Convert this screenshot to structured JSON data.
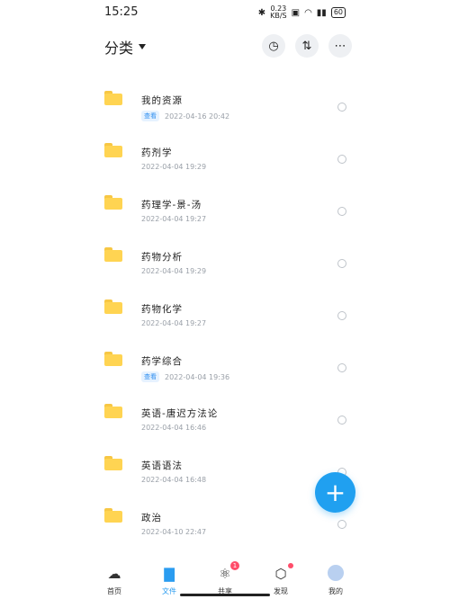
{
  "status": {
    "time": "15:25",
    "net_speed_top": "0.23",
    "net_speed_bottom": "KB/S",
    "battery": "60"
  },
  "header": {
    "title": "分类",
    "history_icon": "history-icon",
    "sort_icon": "sort-icon",
    "more_icon": "more-icon"
  },
  "files": [
    {
      "name": "我的资源",
      "tag": "查看",
      "date": "2022-04-16  20:42"
    },
    {
      "name": "药剂学",
      "tag": "",
      "date": "2022-04-04  19:29"
    },
    {
      "name": "药理学-景-汤",
      "tag": "",
      "date": "2022-04-04  19:27"
    },
    {
      "name": "药物分析",
      "tag": "",
      "date": "2022-04-04  19:29"
    },
    {
      "name": "药物化学",
      "tag": "",
      "date": "2022-04-04  19:27"
    },
    {
      "name": "药学综合",
      "tag": "查看",
      "date": "2022-04-04  19:36"
    },
    {
      "name": "英语-唐迟方法论",
      "tag": "",
      "date": "2022-04-04  16:46"
    },
    {
      "name": "英语语法",
      "tag": "",
      "date": "2022-04-04  16:48"
    },
    {
      "name": "政治",
      "tag": "",
      "date": "2022-04-10  22:47"
    }
  ],
  "fab": {
    "label": "+"
  },
  "nav": {
    "home": "首页",
    "files": "文件",
    "share": "共享",
    "share_badge": "1",
    "discover": "发现",
    "mine": "我的"
  },
  "colors": {
    "accent": "#20a0f0",
    "folder": "#ffd452",
    "badge": "#ff4d6a"
  }
}
